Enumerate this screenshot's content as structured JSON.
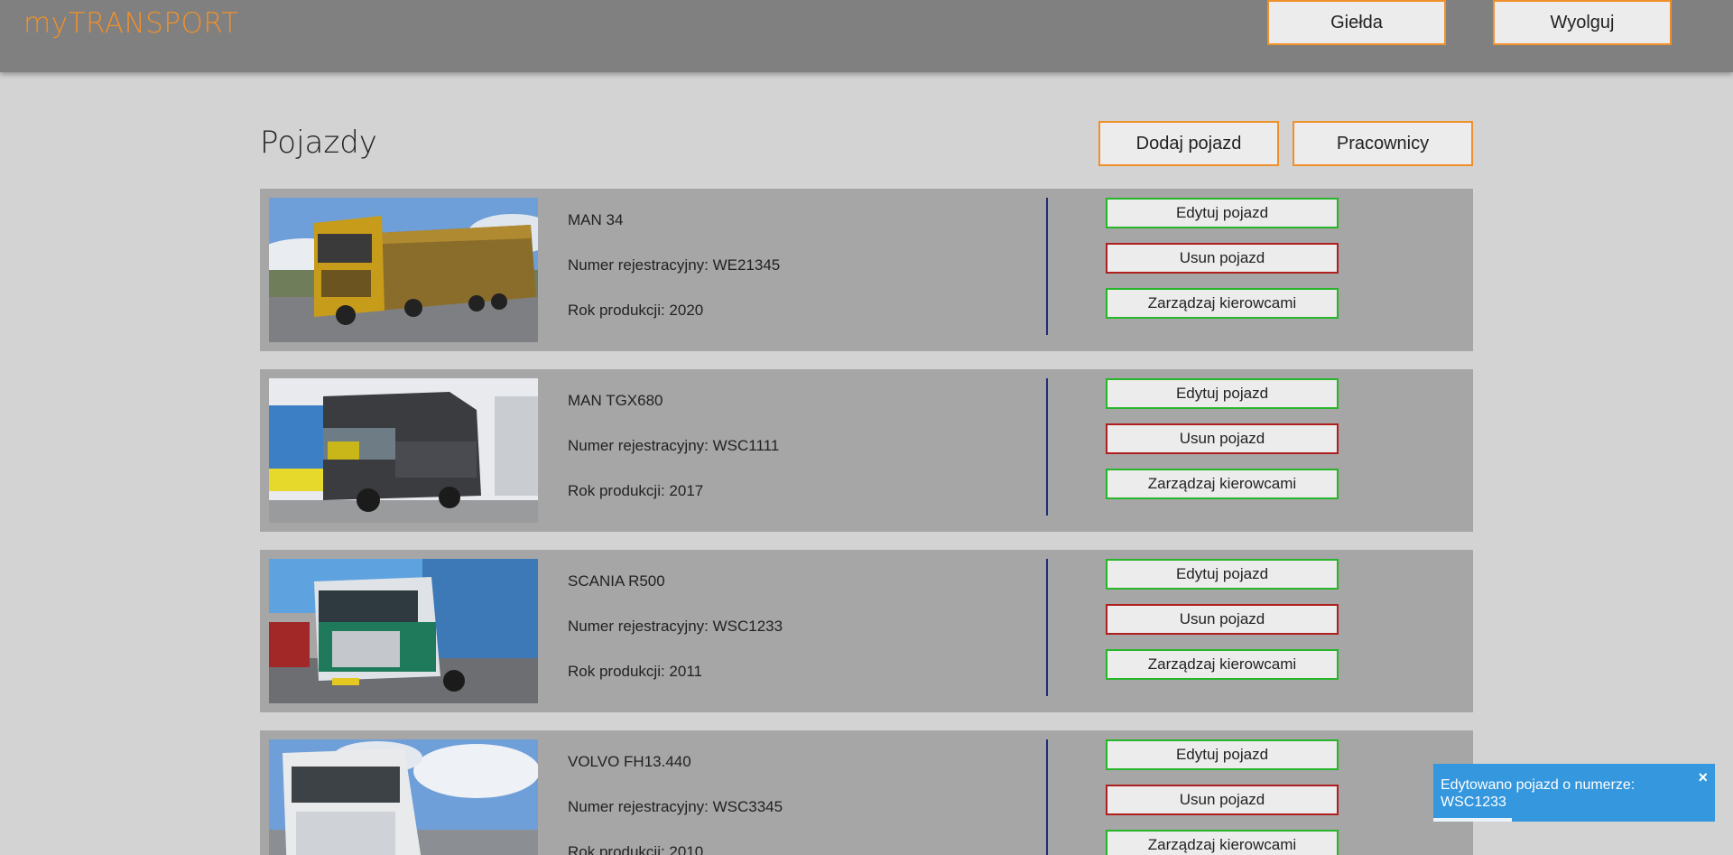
{
  "app": {
    "logo": "myTRANSPORT",
    "nav": {
      "exchange_label": "Giełda",
      "logout_label": "Wyolguj"
    }
  },
  "page": {
    "title": "Pojazdy",
    "add_vehicle_label": "Dodaj pojazd",
    "employees_label": "Pracownicy"
  },
  "vehicles": [
    {
      "name": "MAN 34",
      "registration": "Numer rejestracyjny: WE21345",
      "year": "Rok produkcji: 2020",
      "edit_label": "Edytuj pojazd",
      "delete_label": "Usun pojazd",
      "drivers_label": "Zarządzaj kierowcami"
    },
    {
      "name": "MAN TGX680",
      "registration": "Numer rejestracyjny: WSC1111",
      "year": "Rok produkcji: 2017",
      "edit_label": "Edytuj pojazd",
      "delete_label": "Usun pojazd",
      "drivers_label": "Zarządzaj kierowcami"
    },
    {
      "name": "SCANIA R500",
      "registration": "Numer rejestracyjny: WSC1233",
      "year": "Rok produkcji: 2011",
      "edit_label": "Edytuj pojazd",
      "delete_label": "Usun pojazd",
      "drivers_label": "Zarządzaj kierowcami"
    },
    {
      "name": "VOLVO FH13.440",
      "registration": "Numer rejestracyjny: WSC3345",
      "year": "Rok produkcji: 2010",
      "edit_label": "Edytuj pojazd",
      "delete_label": "Usun pojazd",
      "drivers_label": "Zarządzaj kierowcami"
    }
  ],
  "toast": {
    "message": "Edytowano pojazd o numerze: WSC1233",
    "close_icon": "×",
    "progress": 0.28
  },
  "colors": {
    "accent": "#f0902a",
    "edit_border": "#27b52a",
    "delete_border": "#b01f1f",
    "divider": "#1f2d7a",
    "toast": "#3597dd"
  }
}
